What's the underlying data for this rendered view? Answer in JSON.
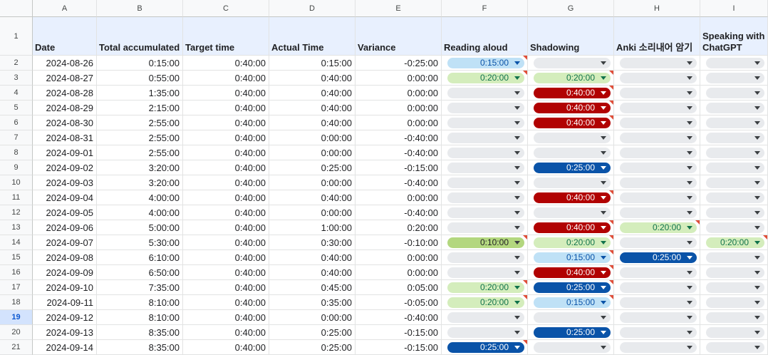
{
  "column_letters": [
    "A",
    "B",
    "C",
    "D",
    "E",
    "F",
    "G",
    "H",
    "I"
  ],
  "headers": [
    "Date",
    "Total accumulated",
    "Target time",
    "Actual Time",
    "Variance",
    "Reading aloud",
    "Shadowing",
    "Anki 소리내어 암기",
    "Speaking with ChatGPT"
  ],
  "selected_row": "19",
  "colors": {
    "red": "#b10202",
    "blue": "#0a53a8",
    "green": "#d4edbc",
    "lightblue": "#bfe1f6",
    "lime": "#b3d77f",
    "header_bg": "#e8f0fe"
  },
  "rows": [
    {
      "n": "2",
      "date": "2024-08-26",
      "total": "0:15:00",
      "target": "0:40:00",
      "actual": "0:15:00",
      "variance": "-0:25:00",
      "reading": {
        "v": "0:15:00",
        "c": "lightblue",
        "note": true
      },
      "shadowing": {
        "v": "",
        "c": ""
      },
      "anki": {
        "v": "",
        "c": ""
      },
      "chatgpt": {
        "v": "",
        "c": ""
      }
    },
    {
      "n": "3",
      "date": "2024-08-27",
      "total": "0:55:00",
      "target": "0:40:00",
      "actual": "0:40:00",
      "variance": "0:00:00",
      "reading": {
        "v": "0:20:00",
        "c": "green",
        "note": true
      },
      "shadowing": {
        "v": "0:20:00",
        "c": "green",
        "note": true
      },
      "anki": {
        "v": "",
        "c": ""
      },
      "chatgpt": {
        "v": "",
        "c": ""
      }
    },
    {
      "n": "4",
      "date": "2024-08-28",
      "total": "1:35:00",
      "target": "0:40:00",
      "actual": "0:40:00",
      "variance": "0:00:00",
      "reading": {
        "v": "",
        "c": ""
      },
      "shadowing": {
        "v": "0:40:00",
        "c": "red",
        "note": true
      },
      "anki": {
        "v": "",
        "c": ""
      },
      "chatgpt": {
        "v": "",
        "c": ""
      }
    },
    {
      "n": "5",
      "date": "2024-08-29",
      "total": "2:15:00",
      "target": "0:40:00",
      "actual": "0:40:00",
      "variance": "0:00:00",
      "reading": {
        "v": "",
        "c": ""
      },
      "shadowing": {
        "v": "0:40:00",
        "c": "red",
        "note": true
      },
      "anki": {
        "v": "",
        "c": ""
      },
      "chatgpt": {
        "v": "",
        "c": ""
      }
    },
    {
      "n": "6",
      "date": "2024-08-30",
      "total": "2:55:00",
      "target": "0:40:00",
      "actual": "0:40:00",
      "variance": "0:00:00",
      "reading": {
        "v": "",
        "c": ""
      },
      "shadowing": {
        "v": "0:40:00",
        "c": "red",
        "note": true
      },
      "anki": {
        "v": "",
        "c": ""
      },
      "chatgpt": {
        "v": "",
        "c": ""
      }
    },
    {
      "n": "7",
      "date": "2024-08-31",
      "total": "2:55:00",
      "target": "0:40:00",
      "actual": "0:00:00",
      "variance": "-0:40:00",
      "reading": {
        "v": "",
        "c": ""
      },
      "shadowing": {
        "v": "",
        "c": ""
      },
      "anki": {
        "v": "",
        "c": ""
      },
      "chatgpt": {
        "v": "",
        "c": ""
      }
    },
    {
      "n": "8",
      "date": "2024-09-01",
      "total": "2:55:00",
      "target": "0:40:00",
      "actual": "0:00:00",
      "variance": "-0:40:00",
      "reading": {
        "v": "",
        "c": ""
      },
      "shadowing": {
        "v": "",
        "c": ""
      },
      "anki": {
        "v": "",
        "c": ""
      },
      "chatgpt": {
        "v": "",
        "c": ""
      }
    },
    {
      "n": "9",
      "date": "2024-09-02",
      "total": "3:20:00",
      "target": "0:40:00",
      "actual": "0:25:00",
      "variance": "-0:15:00",
      "reading": {
        "v": "",
        "c": ""
      },
      "shadowing": {
        "v": "0:25:00",
        "c": "blue"
      },
      "anki": {
        "v": "",
        "c": ""
      },
      "chatgpt": {
        "v": "",
        "c": ""
      }
    },
    {
      "n": "10",
      "date": "2024-09-03",
      "total": "3:20:00",
      "target": "0:40:00",
      "actual": "0:00:00",
      "variance": "-0:40:00",
      "reading": {
        "v": "",
        "c": ""
      },
      "shadowing": {
        "v": "",
        "c": ""
      },
      "anki": {
        "v": "",
        "c": ""
      },
      "chatgpt": {
        "v": "",
        "c": ""
      }
    },
    {
      "n": "11",
      "date": "2024-09-04",
      "total": "4:00:00",
      "target": "0:40:00",
      "actual": "0:40:00",
      "variance": "0:00:00",
      "reading": {
        "v": "",
        "c": ""
      },
      "shadowing": {
        "v": "0:40:00",
        "c": "red",
        "note": true
      },
      "anki": {
        "v": "",
        "c": ""
      },
      "chatgpt": {
        "v": "",
        "c": ""
      }
    },
    {
      "n": "12",
      "date": "2024-09-05",
      "total": "4:00:00",
      "target": "0:40:00",
      "actual": "0:00:00",
      "variance": "-0:40:00",
      "reading": {
        "v": "",
        "c": ""
      },
      "shadowing": {
        "v": "",
        "c": ""
      },
      "anki": {
        "v": "",
        "c": ""
      },
      "chatgpt": {
        "v": "",
        "c": ""
      }
    },
    {
      "n": "13",
      "date": "2024-09-06",
      "total": "5:00:00",
      "target": "0:40:00",
      "actual": "1:00:00",
      "variance": "0:20:00",
      "reading": {
        "v": "",
        "c": ""
      },
      "shadowing": {
        "v": "0:40:00",
        "c": "red",
        "note": true
      },
      "anki": {
        "v": "0:20:00",
        "c": "green",
        "note": true
      },
      "chatgpt": {
        "v": "",
        "c": ""
      }
    },
    {
      "n": "14",
      "date": "2024-09-07",
      "total": "5:30:00",
      "target": "0:40:00",
      "actual": "0:30:00",
      "variance": "-0:10:00",
      "reading": {
        "v": "0:10:00",
        "c": "lime",
        "note": true
      },
      "shadowing": {
        "v": "0:20:00",
        "c": "green",
        "note": true
      },
      "anki": {
        "v": "",
        "c": ""
      },
      "chatgpt": {
        "v": "0:20:00",
        "c": "green",
        "note": true
      }
    },
    {
      "n": "15",
      "date": "2024-09-08",
      "total": "6:10:00",
      "target": "0:40:00",
      "actual": "0:40:00",
      "variance": "0:00:00",
      "reading": {
        "v": "",
        "c": ""
      },
      "shadowing": {
        "v": "0:15:00",
        "c": "lightblue",
        "note": true
      },
      "anki": {
        "v": "0:25:00",
        "c": "blue"
      },
      "chatgpt": {
        "v": "",
        "c": ""
      }
    },
    {
      "n": "16",
      "date": "2024-09-09",
      "total": "6:50:00",
      "target": "0:40:00",
      "actual": "0:40:00",
      "variance": "0:00:00",
      "reading": {
        "v": "",
        "c": ""
      },
      "shadowing": {
        "v": "0:40:00",
        "c": "red",
        "note": true
      },
      "anki": {
        "v": "",
        "c": ""
      },
      "chatgpt": {
        "v": "",
        "c": ""
      }
    },
    {
      "n": "17",
      "date": "2024-09-10",
      "total": "7:35:00",
      "target": "0:40:00",
      "actual": "0:45:00",
      "variance": "0:05:00",
      "reading": {
        "v": "0:20:00",
        "c": "green",
        "note": true
      },
      "shadowing": {
        "v": "0:25:00",
        "c": "blue",
        "note": true
      },
      "anki": {
        "v": "",
        "c": ""
      },
      "chatgpt": {
        "v": "",
        "c": ""
      }
    },
    {
      "n": "18",
      "date": "2024-09-11",
      "total": "8:10:00",
      "target": "0:40:00",
      "actual": "0:35:00",
      "variance": "-0:05:00",
      "reading": {
        "v": "0:20:00",
        "c": "green",
        "note": true
      },
      "shadowing": {
        "v": "0:15:00",
        "c": "lightblue",
        "note": true
      },
      "anki": {
        "v": "",
        "c": ""
      },
      "chatgpt": {
        "v": "",
        "c": ""
      }
    },
    {
      "n": "19",
      "date": "2024-09-12",
      "total": "8:10:00",
      "target": "0:40:00",
      "actual": "0:00:00",
      "variance": "-0:40:00",
      "reading": {
        "v": "",
        "c": ""
      },
      "shadowing": {
        "v": "",
        "c": ""
      },
      "anki": {
        "v": "",
        "c": ""
      },
      "chatgpt": {
        "v": "",
        "c": ""
      }
    },
    {
      "n": "20",
      "date": "2024-09-13",
      "total": "8:35:00",
      "target": "0:40:00",
      "actual": "0:25:00",
      "variance": "-0:15:00",
      "reading": {
        "v": "",
        "c": ""
      },
      "shadowing": {
        "v": "0:25:00",
        "c": "blue"
      },
      "anki": {
        "v": "",
        "c": ""
      },
      "chatgpt": {
        "v": "",
        "c": ""
      }
    },
    {
      "n": "21",
      "date": "2024-09-14",
      "total": "8:35:00",
      "target": "0:40:00",
      "actual": "0:25:00",
      "variance": "-0:15:00",
      "reading": {
        "v": "0:25:00",
        "c": "blue",
        "note": true
      },
      "shadowing": {
        "v": "",
        "c": ""
      },
      "anki": {
        "v": "",
        "c": ""
      },
      "chatgpt": {
        "v": "",
        "c": ""
      }
    }
  ]
}
